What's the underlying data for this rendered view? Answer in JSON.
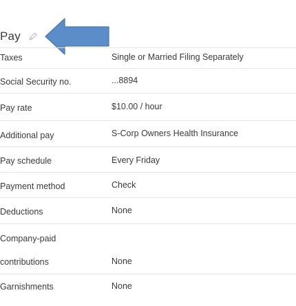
{
  "section": {
    "title": "Pay",
    "edit_icon": "pencil-icon",
    "annotation_color": "#5b8ec9"
  },
  "rows": [
    {
      "label": "Taxes",
      "value": "Single or Married Filing Separately"
    },
    {
      "label": "Social Security no.",
      "value": "...8894"
    },
    {
      "label": "Pay rate",
      "value": "$10.00 / hour"
    },
    {
      "label": "Additional pay",
      "value": "S-Corp Owners Health Insurance"
    },
    {
      "label": "Pay schedule",
      "value": "Every Friday"
    },
    {
      "label": "Payment method",
      "value": "Check"
    },
    {
      "label": "Deductions",
      "value": "None"
    },
    {
      "label": "Company-paid",
      "value": ""
    },
    {
      "label": "contributions",
      "value": "None"
    },
    {
      "label": "Garnishments",
      "value": "None"
    }
  ]
}
